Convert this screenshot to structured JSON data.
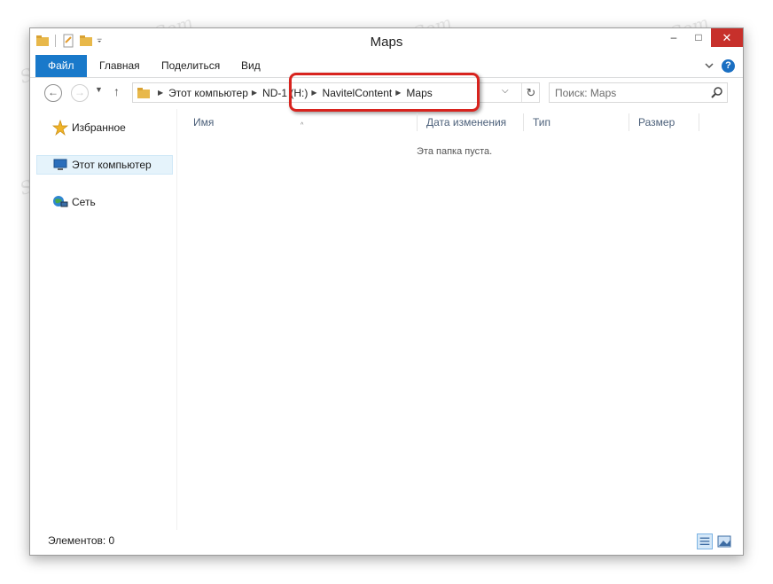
{
  "window": {
    "title": "Maps",
    "controls": {
      "minimize": "–",
      "maximize": "□",
      "close": "✕"
    }
  },
  "ribbon": {
    "tabs": [
      {
        "label": "Файл",
        "active": true
      },
      {
        "label": "Главная"
      },
      {
        "label": "Поделиться"
      },
      {
        "label": "Вид"
      }
    ],
    "help": "?"
  },
  "navigation": {
    "address": {
      "crumbs": [
        "Этот компьютер",
        "ND-1 (H:)",
        "NavitelContent",
        "Maps"
      ]
    },
    "search": {
      "placeholder": "Поиск: Maps"
    }
  },
  "sidebar": {
    "items": [
      {
        "label": "Избранное",
        "icon": "star-icon"
      },
      {
        "label": "Этот компьютер",
        "icon": "computer-icon",
        "selected": true
      },
      {
        "label": "Сеть",
        "icon": "network-icon"
      }
    ]
  },
  "columns": [
    "Имя",
    "Дата изменения",
    "Тип",
    "Размер"
  ],
  "content": {
    "empty_message": "Эта папка пуста."
  },
  "status": {
    "items_count": "Элементов: 0"
  },
  "watermark": "Soringpcrepair.Com",
  "colors": {
    "accent": "#1979ca",
    "close": "#c7302b",
    "highlight": "#d8231e",
    "selection": "#e5f3fb"
  }
}
